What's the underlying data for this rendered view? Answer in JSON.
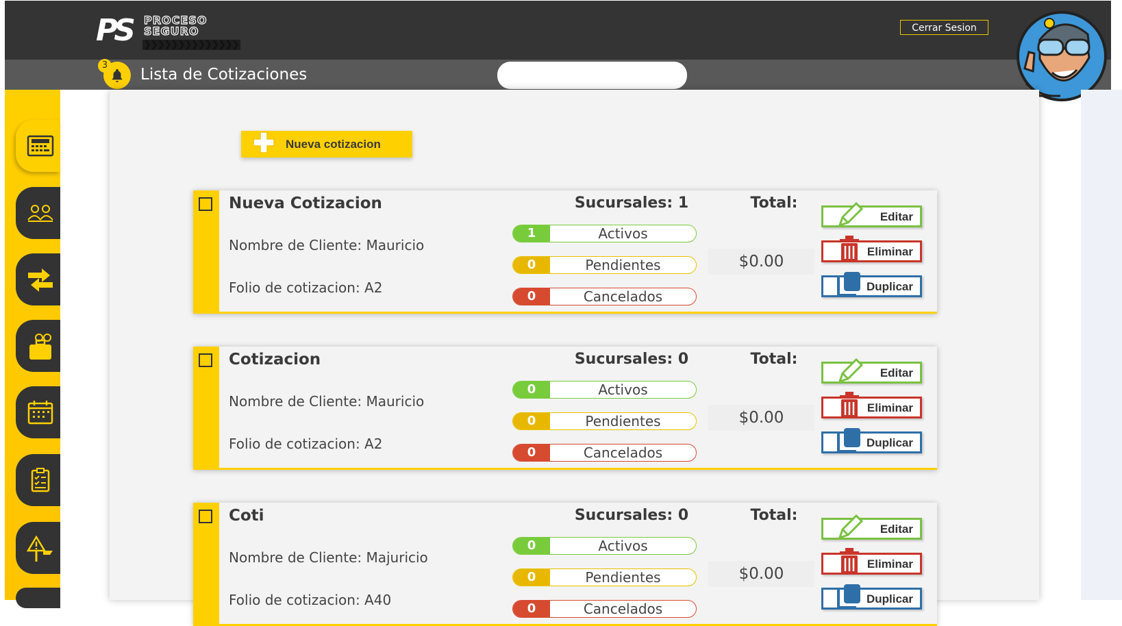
{
  "brand": {
    "logo_mark": "PS",
    "logo_line1": "PROCESO",
    "logo_line2": "SEGURO",
    "logo_chevrons": "❯❯❯❯❯❯❯❯❯❯❯❯❯❯"
  },
  "header": {
    "logout_label": "Cerrar Sesion",
    "title": "Lista de Cotizaciones",
    "notifications_count": "3",
    "search_value": ""
  },
  "sidebar": {
    "items": [
      {
        "icon": "calculator-icon",
        "active": true
      },
      {
        "icon": "clients-icon",
        "active": false
      },
      {
        "icon": "transfer-icon",
        "active": false
      },
      {
        "icon": "briefcase-icon",
        "active": false
      },
      {
        "icon": "calendar-icon",
        "active": false
      },
      {
        "icon": "checklist-icon",
        "active": false
      },
      {
        "icon": "warning-sign-icon",
        "active": false
      }
    ]
  },
  "toolbar": {
    "new_quote_label": "Nueva cotizacion"
  },
  "labels": {
    "active": "Activos",
    "pending": "Pendientes",
    "cancelled": "Cancelados",
    "total": "Total:",
    "edit": "Editar",
    "delete": "Eliminar",
    "duplicate": "Duplicar"
  },
  "quotes": [
    {
      "name": "Nueva Cotizacion",
      "client": "Nombre de Cliente: Mauricio",
      "folio": "Folio de cotizacion: A2",
      "branches": "Sucursales: 1",
      "active": "1",
      "pending": "0",
      "cancelled": "0",
      "total": "$0.00"
    },
    {
      "name": "Cotizacion",
      "client": "Nombre de Cliente: Mauricio",
      "folio": "Folio de cotizacion: A2",
      "branches": "Sucursales: 0",
      "active": "0",
      "pending": "0",
      "cancelled": "0",
      "total": "$0.00"
    },
    {
      "name": "Coti",
      "client": "Nombre de Cliente: Majuricio",
      "folio": "Folio de cotizacion: A40",
      "branches": "Sucursales: 0",
      "active": "0",
      "pending": "0",
      "cancelled": "0",
      "total": "$0.00"
    }
  ],
  "colors": {
    "accent": "#ffd000",
    "topbar": "#343434",
    "subbar": "#595959",
    "active_green": "#78cc3c",
    "pending_yellow": "#e8b800",
    "cancel_red": "#d64a30",
    "edit_border": "#7ac143",
    "delete_border": "#c9352a",
    "duplicate_border": "#2f6fa8"
  }
}
